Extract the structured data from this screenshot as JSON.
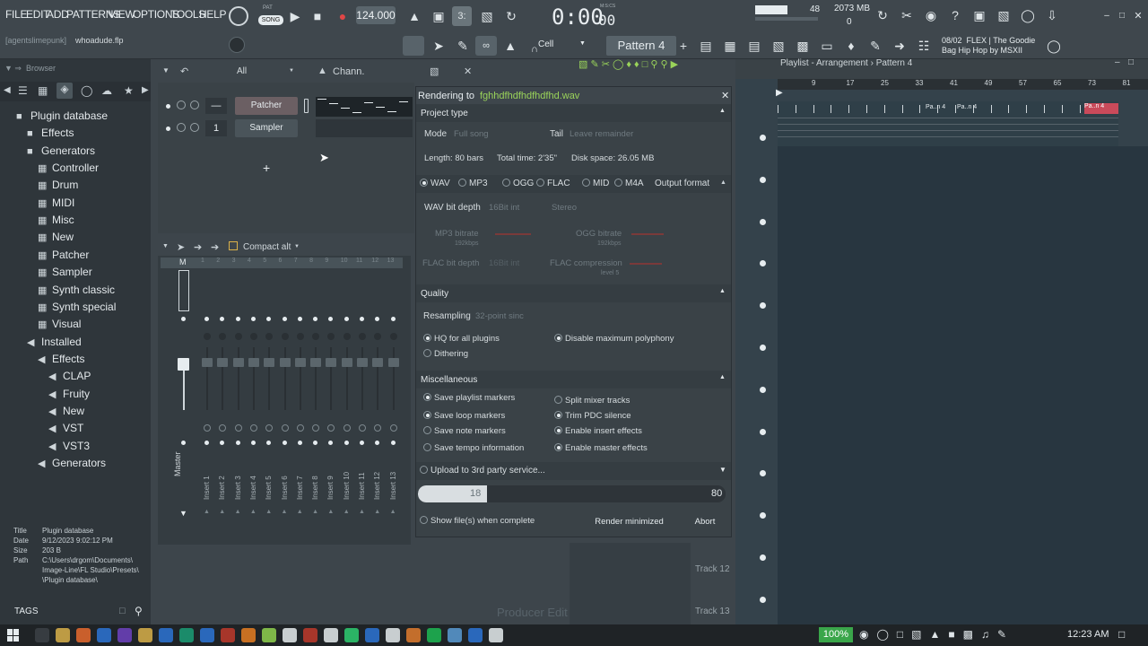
{
  "menu": [
    "FILE",
    "EDIT",
    "ADD",
    "PATTERNS",
    "VIEW",
    "OPTIONS",
    "TOOLS",
    "HELP"
  ],
  "transport": {
    "pat_label": "PAT",
    "song_label": "SONG",
    "tempo": "124.000",
    "time": "0:00",
    "time_small": "00",
    "time_unit": "M:S:CS"
  },
  "perf": {
    "cpu": "48",
    "memory": "2073 MB",
    "voices": "0"
  },
  "project": {
    "user": "[agentslimepunk]",
    "file": "whoadude.flp"
  },
  "snap": {
    "mode": "Cell",
    "pattern": "Pattern 4"
  },
  "news": {
    "date": "08/02",
    "line1": "FLEX | The Goodie",
    "line2": "Bag Hip Hop by MSXII"
  },
  "browser": {
    "title": "Browser",
    "filter": "All",
    "items": [
      {
        "label": "Plugin database",
        "depth": 0,
        "icon": "folder-icon"
      },
      {
        "label": "Effects",
        "depth": 1,
        "icon": "folder-icon"
      },
      {
        "label": "Generators",
        "depth": 1,
        "icon": "folder-icon"
      },
      {
        "label": "Controller",
        "depth": 2,
        "icon": "plugin-icon"
      },
      {
        "label": "Drum",
        "depth": 2,
        "icon": "plugin-icon"
      },
      {
        "label": "MIDI",
        "depth": 2,
        "icon": "plugin-icon"
      },
      {
        "label": "Misc",
        "depth": 2,
        "icon": "plugin-icon"
      },
      {
        "label": "New",
        "depth": 2,
        "icon": "plugin-icon"
      },
      {
        "label": "Patcher",
        "depth": 2,
        "icon": "plugin-icon"
      },
      {
        "label": "Sampler",
        "depth": 2,
        "icon": "plugin-icon"
      },
      {
        "label": "Synth classic",
        "depth": 2,
        "icon": "plugin-icon"
      },
      {
        "label": "Synth special",
        "depth": 2,
        "icon": "plugin-icon"
      },
      {
        "label": "Visual",
        "depth": 2,
        "icon": "plugin-icon"
      },
      {
        "label": "Installed",
        "depth": 1,
        "icon": "speaker-icon"
      },
      {
        "label": "Effects",
        "depth": 2,
        "icon": "speaker-icon"
      },
      {
        "label": "CLAP",
        "depth": 3,
        "icon": "speaker-icon"
      },
      {
        "label": "Fruity",
        "depth": 3,
        "icon": "speaker-icon"
      },
      {
        "label": "New",
        "depth": 3,
        "icon": "speaker-icon"
      },
      {
        "label": "VST",
        "depth": 3,
        "icon": "speaker-icon"
      },
      {
        "label": "VST3",
        "depth": 3,
        "icon": "speaker-icon"
      },
      {
        "label": "Generators",
        "depth": 2,
        "icon": "speaker-icon"
      }
    ],
    "info": {
      "title_k": "Title",
      "title_v": "Plugin database",
      "date_k": "Date",
      "date_v": "9/12/2023 9:02:12 PM",
      "size_k": "Size",
      "size_v": "203 B",
      "path_k": "Path",
      "path_v1": "C:\\Users\\drgom\\Documents\\",
      "path_v2": "Image-Line\\FL Studio\\Presets\\",
      "path_v3": "\\Plugin database\\"
    },
    "tags": "TAGS"
  },
  "channel_rack": {
    "title": "Chann.",
    "channels": [
      {
        "name": "Patcher",
        "num": "—"
      },
      {
        "name": "Sampler",
        "num": "1"
      }
    ]
  },
  "mixer": {
    "title": "Compact alt",
    "master": "Master",
    "inserts": [
      "Insert 1",
      "Insert 2",
      "Insert 3",
      "Insert 4",
      "Insert 5",
      "Insert 6",
      "Insert 7",
      "Insert 8",
      "Insert 9",
      "Insert 10",
      "Insert 11",
      "Insert 12",
      "Insert 13"
    ],
    "numbers": [
      "1",
      "2",
      "3",
      "4",
      "5",
      "6",
      "7",
      "8",
      "9",
      "10",
      "11",
      "12",
      "13"
    ],
    "m": "M"
  },
  "render": {
    "title_prefix": "Rendering to ",
    "filename": "fghhdfhdfhdfhdfhd.wav",
    "project_type": "Project type",
    "mode_label": "Mode",
    "mode_value": "Full song",
    "tail_label": "Tail",
    "tail_value": "Leave remainder",
    "length": "Length: 80 bars",
    "total_time": "Total time: 2'35\"",
    "disk_space": "Disk space: 26.05 MB",
    "formats": [
      {
        "label": "WAV",
        "on": true
      },
      {
        "label": "MP3",
        "on": false
      },
      {
        "label": "OGG",
        "on": false
      },
      {
        "label": "FLAC",
        "on": false
      },
      {
        "label": "MID",
        "on": false
      },
      {
        "label": "M4A",
        "on": false
      }
    ],
    "output_format": "Output format",
    "wav_bit_depth": "WAV bit depth",
    "wav_bit_value": "16Bit int",
    "channels_value": "Stereo",
    "mp3_bitrate": "MP3 bitrate",
    "mp3_bitrate_v": "192kbps",
    "ogg_bitrate": "OGG bitrate",
    "ogg_bitrate_v": "192kbps",
    "flac_bit_depth": "FLAC bit depth",
    "flac_bit_v": "16Bit int",
    "flac_compression": "FLAC compression",
    "flac_compression_v": "level 5",
    "quality": "Quality",
    "resampling": "Resampling",
    "resampling_value": "32-point sinc",
    "hq": "HQ for all plugins",
    "disable_poly": "Disable maximum polyphony",
    "dithering": "Dithering",
    "misc": "Miscellaneous",
    "save_playlist": "Save playlist markers",
    "split_mixer": "Split mixer tracks",
    "save_loop": "Save loop markers",
    "trim_pdc": "Trim PDC silence",
    "save_note": "Save note markers",
    "enable_insert": "Enable insert effects",
    "save_tempo": "Save tempo information",
    "enable_master": "Enable master effects",
    "upload": "Upload to 3rd party service...",
    "progress_current": "18",
    "progress_total": "80",
    "progress_fraction": 0.225,
    "show_files": "Show file(s) when complete",
    "render_minimized": "Render minimized",
    "abort": "Abort"
  },
  "playlist": {
    "title": "Playlist - Arrangement › Pattern 4",
    "bars": [
      "9",
      "17",
      "25",
      "33",
      "41",
      "49",
      "57",
      "65",
      "73",
      "81"
    ],
    "tracks": [
      "Track 12",
      "Track 13"
    ],
    "clip_label": "Pa..n 4",
    "watermark": "Producer Edit"
  },
  "taskbar": {
    "zoom": "100%",
    "time": "12:23 AM"
  },
  "colors": {
    "accent": "#8fd14f",
    "render_bg": "#3a4247",
    "playlist_bg": "#34424b",
    "clip_red": "#c94a5a"
  }
}
